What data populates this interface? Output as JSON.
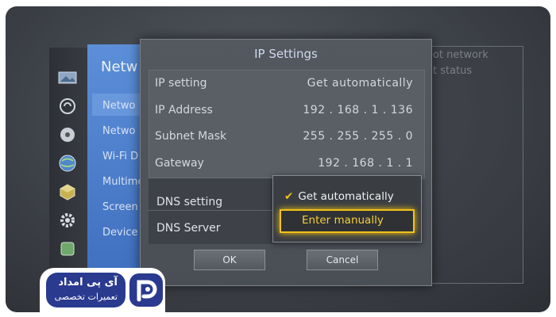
{
  "background": {
    "ghost_lines": [
      "oot network",
      "et status"
    ]
  },
  "network_menu": {
    "title": "Netw",
    "items": [
      "Netwo",
      "Netwo",
      "Wi-Fi D",
      "Multime",
      "Screen",
      "Device"
    ]
  },
  "dialog": {
    "title": "IP Settings",
    "rows": [
      {
        "label": "IP setting",
        "value": "Get automatically"
      },
      {
        "label": "IP Address",
        "value": "192 . 168 . 1 . 136"
      },
      {
        "label": "Subnet Mask",
        "value": "255 . 255 . 255 . 0"
      },
      {
        "label": "Gateway",
        "value": "192 . 168 . 1 . 1"
      }
    ],
    "dns_setting_label": "DNS setting",
    "dns_server_label": "DNS Server",
    "dropdown": {
      "option_selected": "Get automatically",
      "option_focused": "Enter manually"
    },
    "ok_label": "OK",
    "cancel_label": "Cancel"
  },
  "badge": {
    "line1": "آی پی امداد",
    "line2": "تعمیرات تخصصی"
  },
  "colors": {
    "highlight": "#f2c318",
    "menu_blue": "#4a7bc9",
    "badge_blue": "#2a3a8f"
  }
}
